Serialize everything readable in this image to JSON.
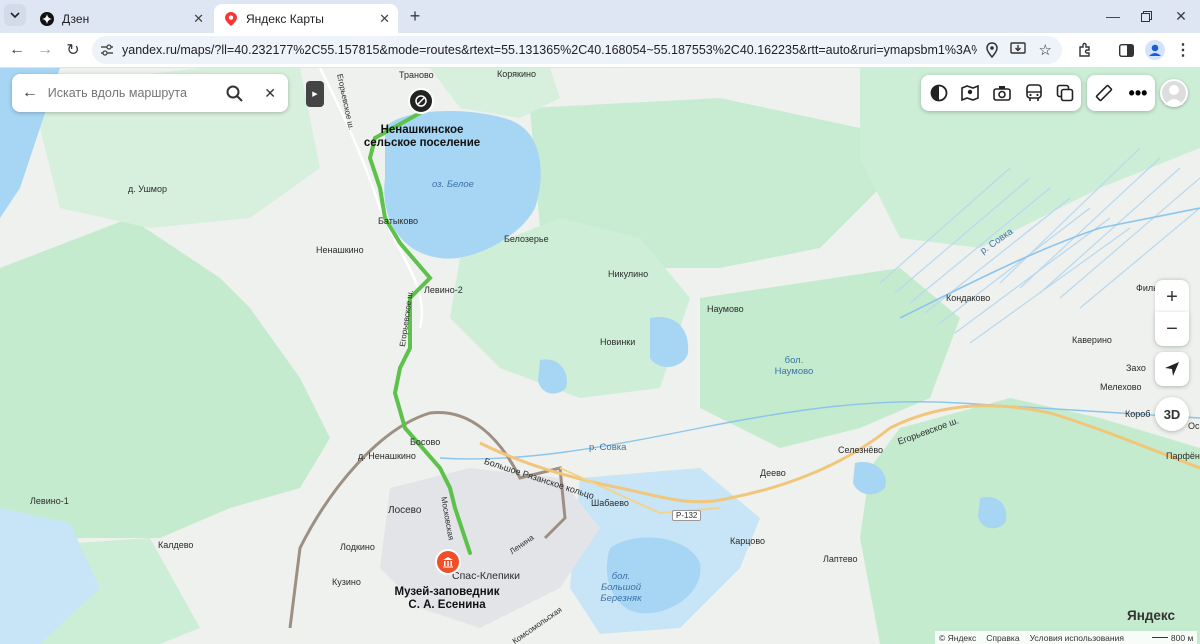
{
  "browser": {
    "tabs": [
      {
        "title": "Дзен",
        "icon": "dzen-icon"
      },
      {
        "title": "Яндекс Карты",
        "icon": "yandex-maps-pin-icon"
      }
    ],
    "url": "yandex.ru/maps/?ll=40.232177%2C55.157815&mode=routes&rtext=55.131365%2C40.168054~55.187553%2C40.162235&rtt=auto&ruri=ymapsbm1%3A%2F%2Forg%3Foid%3..."
  },
  "search": {
    "placeholder": "Искать вдоль маршрута"
  },
  "map": {
    "places": {
      "tranovo": "Траново",
      "koryakino": "Корякино",
      "nenashkinskoe": "Ненашкинское сельское поселение",
      "umor": "д. Ушмор",
      "beloe": "оз. Белое",
      "batykovo": "Батыково",
      "belozerye": "Белозерье",
      "nenashkino": "Ненашкино",
      "levino2": "Левино-2",
      "nikulino": "Никулино",
      "naumovo": "Наумово",
      "novinki": "Новинки",
      "bol_naumovo": "бол. Наумово",
      "kondakovo": "Кондаково",
      "kaverino": "Каверино",
      "melekhovo": "Мелехово",
      "zakh": "Захо",
      "korob": "Короб",
      "parfen": "Парфён",
      "fil": "Филь",
      "r_sovka_ne": "р. Совка",
      "r_sovka": "р. Совка",
      "bosovo": "Босово",
      "d_nenashkino": "д. Ненашкино",
      "levino1": "Левино-1",
      "losevo": "Лосево",
      "kaldevo": "Калдево",
      "lodkino": "Лодкино",
      "kuzino": "Кузино",
      "spas": "Спас-Клепики",
      "museum": "Музей-заповедник С. А. Есенина",
      "shabaevo": "Шабаево",
      "deevo": "Деево",
      "selezneve": "Селезнёво",
      "kartsovo": "Карцово",
      "laptevo": "Лаптево",
      "bol_bereznyak": "бол. Большой Березняк",
      "road_egor_n": "Егорьевское ш.",
      "road_egor_mid": "Егорьевское ш.",
      "road_egor_e": "Егорьевское ш.",
      "road_kolco": "Большое Рязанское кольцо",
      "road_r132": "Р-132",
      "street_lenina": "Ленина",
      "street_mosk": "Московская",
      "street_komsom": "Комсомольская",
      "osh": "Ос"
    },
    "footer": {
      "copyright": "© Яндекс",
      "help": "Справка",
      "terms": "Условия использования",
      "scale": "800 м",
      "logo": "Яндекс"
    },
    "controls": {
      "zoom_in": "+",
      "zoom_out": "−",
      "three_d": "3D"
    }
  }
}
